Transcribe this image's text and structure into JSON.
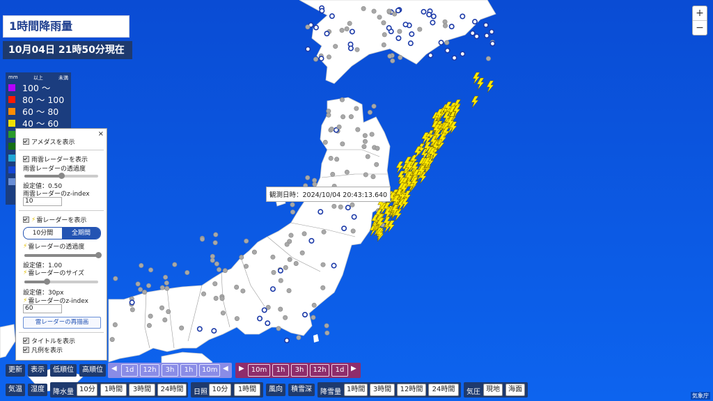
{
  "title": "1時間降雨量",
  "time": {
    "date": "10月04日",
    "hm": "21時50分",
    "status": "現在"
  },
  "zoom": {
    "in": "+",
    "out": "−"
  },
  "legend": {
    "unit": "mm",
    "min_label": "以上",
    "max_label": "未満",
    "rows": [
      {
        "color": "#b400ff",
        "text": "100 〜"
      },
      {
        "color": "#ff1a00",
        "text": "80 〜 100"
      },
      {
        "color": "#ff8c00",
        "text": "60 〜  80"
      },
      {
        "color": "#f0e000",
        "text": "40 〜  60"
      }
    ],
    "hidden_colors": [
      "#2a9b2a",
      "#156f15",
      "#21a7d6",
      "#1446d8",
      "#6a8fd6"
    ]
  },
  "panel": {
    "close": "×",
    "amedas": "アメダスを表示",
    "rain_radar": "雨雲レーダーを表示",
    "rain_opacity_label": "雨雲レーダーの透過度",
    "rain_opacity_value": "設定値：0.50",
    "rain_opacity": 0.5,
    "rain_z_label": "雨雲レーダーのz-index",
    "rain_z_value": "10",
    "thunder_radar": "雷レーダーを表示",
    "seg_10min": "10分間",
    "seg_all": "全期間",
    "thunder_opacity_label": "雷レーダーの透過度",
    "thunder_opacity_value": "設定値：1.00",
    "thunder_opacity": 1.0,
    "thunder_size_label": "雷レーダーのサイズ",
    "thunder_size_value": "設定値：30px",
    "thunder_size": 0.3,
    "thunder_z_label": "雷レーダーのz-index",
    "thunder_z_value": "60",
    "redraw": "雷レーダーの再描画",
    "show_title": "タイトルを表示",
    "show_legend": "凡例を表示"
  },
  "tooltip": "観測日時：2024/10/04 20:43:13.640",
  "toolbar1": {
    "update": "更新",
    "display": "表示",
    "low_order": "低順位",
    "high_order": "高順位",
    "back": [
      "1d",
      "12h",
      "3h",
      "1h",
      "10m"
    ],
    "forward": [
      "10m",
      "1h",
      "3h",
      "12h",
      "1d"
    ]
  },
  "toolbar2": {
    "temp": "気温",
    "humidity": "湿度",
    "precip": "降水量",
    "precip_opts": [
      "10分",
      "1時間",
      "3時間",
      "24時間"
    ],
    "sunshine": "日照",
    "sunshine_opts": [
      "10分",
      "1時間"
    ],
    "wind": "風向",
    "snow_depth": "積雪深",
    "snowfall": "降雪量",
    "snowfall_opts": [
      "1時間",
      "3時間",
      "12時間",
      "24時間"
    ],
    "pressure": "気圧",
    "pressure_opts": [
      "現地",
      "海面"
    ]
  },
  "credit": "気象庁",
  "colors": {
    "sea": "#0a4fd6",
    "land": "#ffffff",
    "bolt": "#ffe800",
    "station_gray": "#a8a8a8",
    "station_blue": "#1c3aa8"
  }
}
